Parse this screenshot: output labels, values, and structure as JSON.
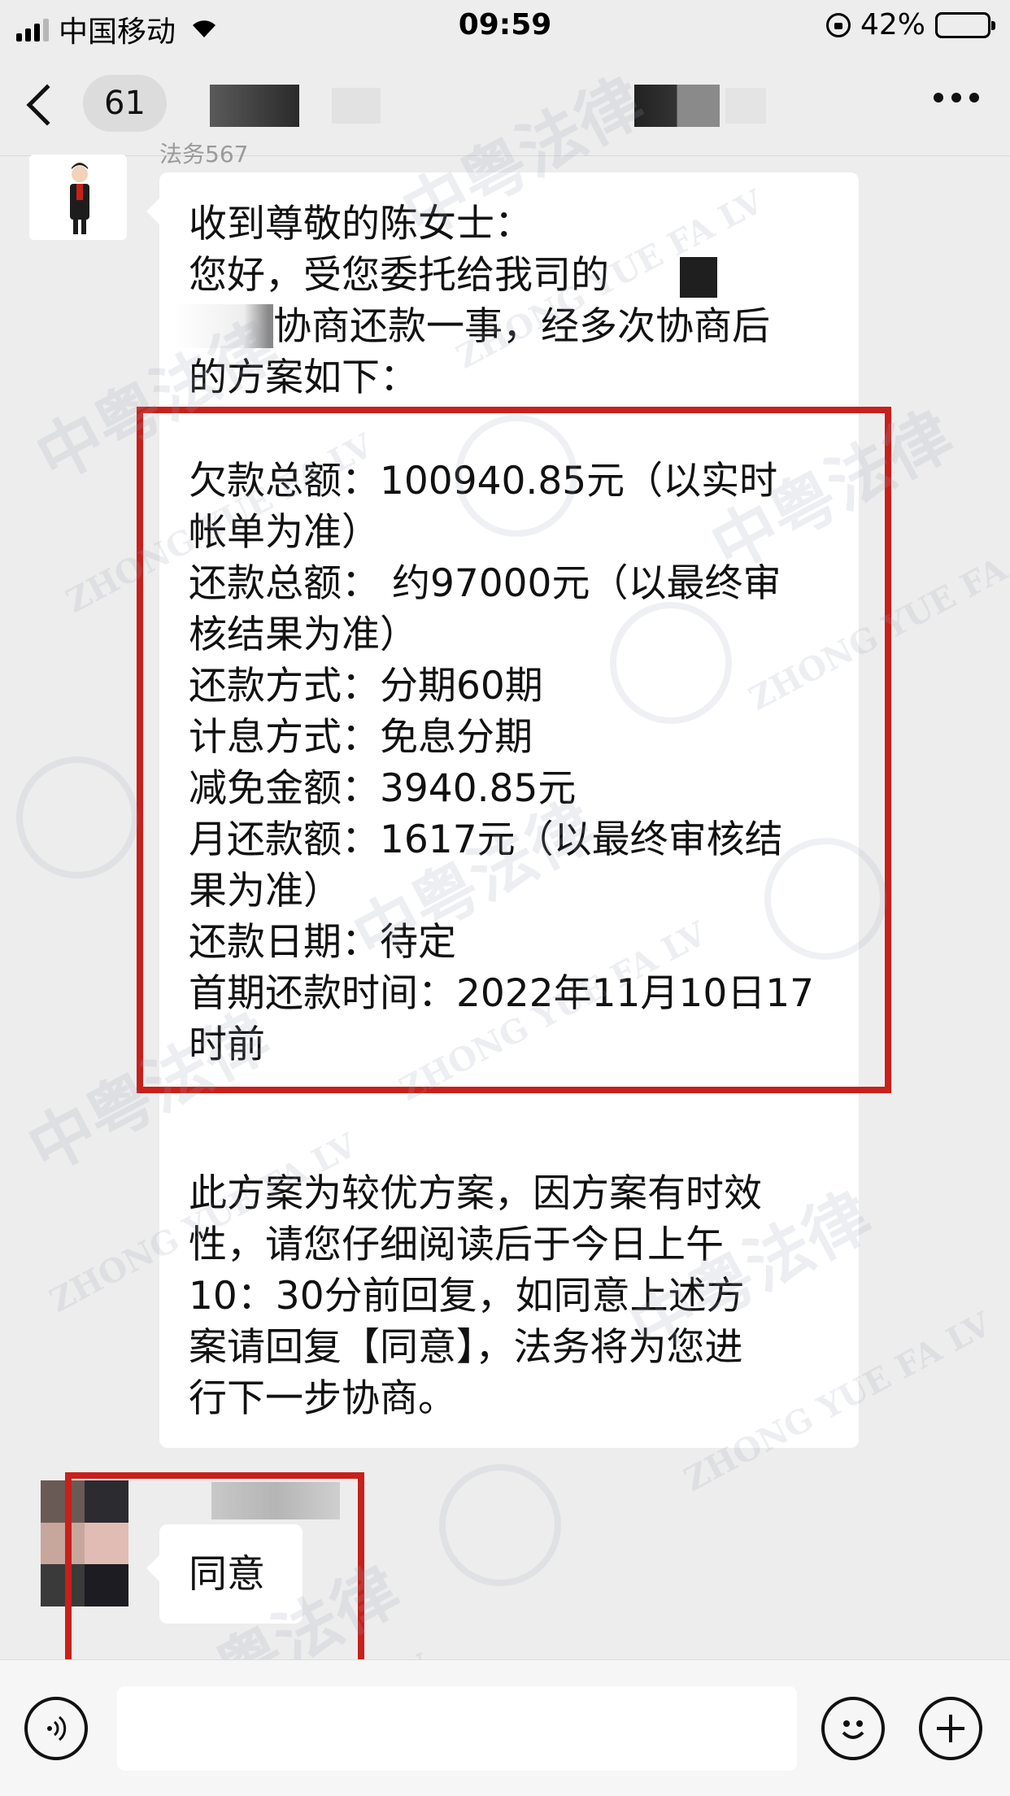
{
  "status_bar": {
    "carrier": "中国移动",
    "time": "09:59",
    "battery": "42%",
    "battery_level": 0.42
  },
  "nav": {
    "unread_count": "61"
  },
  "message": {
    "sender_name": "法务567",
    "intro_lines": [
      "收到尊敬的陈女士：",
      "您好，受您委托给我司的",
      "协商还款一事，经多次协商后",
      "的方案如下："
    ],
    "plan_lines": [
      "欠款总额：100940.85元（以实时",
      "帐单为准）",
      "还款总额： 约97000元（以最终审",
      "核结果为准）",
      "还款方式：分期60期",
      "计息方式：免息分期",
      "减免金额：3940.85元",
      "月还款额：1617元（以最终审核结",
      "果为准）",
      "还款日期：待定",
      "首期还款时间：2022年11月10日17",
      "时前"
    ],
    "closing_lines": [
      "此方案为较优方案，因方案有时效",
      "性，请您仔细阅读后于今日上午",
      "10：30分前回复，如同意上述方",
      "案请回复【同意】，法务将为您进",
      "行下一步协商。"
    ]
  },
  "reply": {
    "text": "同意"
  },
  "watermark": {
    "cn": "中粤法律",
    "en": "ZHONG YUE FA LV",
    "logo": "中"
  },
  "colors": {
    "highlight_red": "#c8201b",
    "chat_bg": "#ededed"
  }
}
